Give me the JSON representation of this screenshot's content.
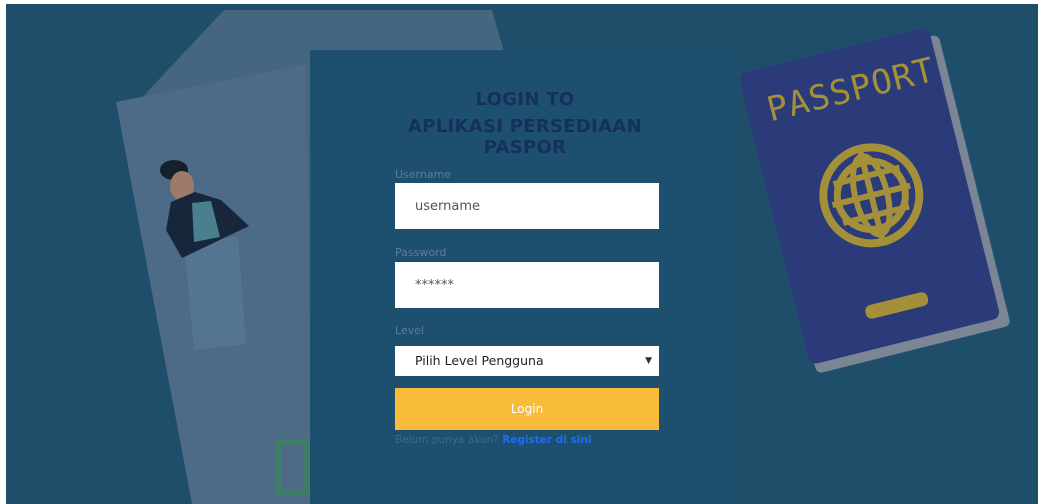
{
  "login": {
    "title_line1": "LOGIN TO",
    "title_line2": "APLIKASI PERSEDIAAN",
    "title_line3": "PASPOR",
    "username_label": "Username",
    "username_placeholder": "username",
    "password_label": "Password",
    "password_placeholder": "******",
    "level_label": "Level",
    "level_selected": "Pilih Level Pengguna",
    "login_button": "Login",
    "register_prompt": "Belum punya akun?",
    "register_link": "Register di sini"
  },
  "background": {
    "passport_text": "PASSPORT"
  },
  "colors": {
    "background": "#1f4e6b",
    "card": "#1d4f6e",
    "title": "#16305e",
    "button": "#f8bb3a",
    "link": "#1d6ef2",
    "passport_cover": "#2b3a78",
    "passport_accent": "#a5903a"
  },
  "icons": {
    "select_arrow": "chevron-down-icon",
    "globe": "globe-icon"
  }
}
